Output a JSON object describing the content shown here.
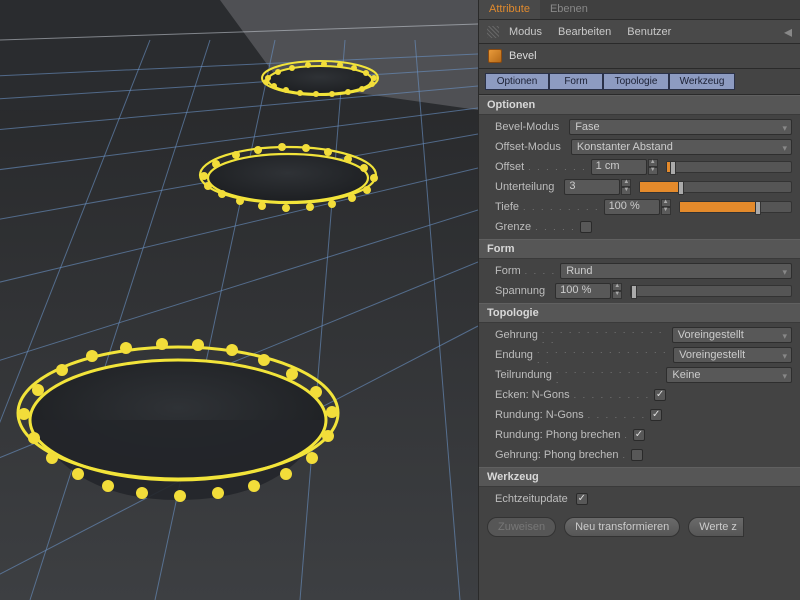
{
  "tabs": {
    "attribute": "Attribute",
    "ebenen": "Ebenen"
  },
  "menu": {
    "modus": "Modus",
    "bearbeiten": "Bearbeiten",
    "benutzer": "Benutzer"
  },
  "tool": {
    "name": "Bevel"
  },
  "subtabs": {
    "optionen": "Optionen",
    "form": "Form",
    "topologie": "Topologie",
    "werkzeug": "Werkzeug"
  },
  "sections": {
    "optionen": "Optionen",
    "form": "Form",
    "topologie": "Topologie",
    "werkzeug": "Werkzeug"
  },
  "optionen": {
    "bevel_modus_label": "Bevel-Modus",
    "bevel_modus_value": "Fase",
    "offset_modus_label": "Offset-Modus",
    "offset_modus_value": "Konstanter Abstand",
    "offset_label": "Offset",
    "offset_value": "1 cm",
    "offset_fill_percent": 3,
    "unterteilung_label": "Unterteilung",
    "unterteilung_value": "3",
    "unterteilung_fill_percent": 25,
    "tiefe_label": "Tiefe",
    "tiefe_value": "100 %",
    "tiefe_fill_percent": 68,
    "grenze_label": "Grenze",
    "grenze_checked": false
  },
  "form": {
    "form_label": "Form",
    "form_value": "Rund",
    "spannung_label": "Spannung",
    "spannung_value": "100 %",
    "spannung_fill_percent": 0
  },
  "topologie": {
    "gehrung_label": "Gehrung",
    "gehrung_value": "Voreingestellt",
    "endung_label": "Endung",
    "endung_value": "Voreingestellt",
    "teilrundung_label": "Teilrundung",
    "teilrundung_value": "Keine",
    "ecken_ngons_label": "Ecken: N-Gons",
    "ecken_ngons_checked": true,
    "rundung_ngons_label": "Rundung: N-Gons",
    "rundung_ngons_checked": true,
    "rundung_phong_label": "Rundung: Phong brechen",
    "rundung_phong_checked": true,
    "gehrung_phong_label": "Gehrung: Phong brechen",
    "gehrung_phong_checked": false
  },
  "werkzeug": {
    "echtzeit_label": "Echtzeitupdate",
    "echtzeit_checked": true,
    "zuweisen": "Zuweisen",
    "neu_transformieren": "Neu transformieren",
    "werte": "Werte z"
  }
}
